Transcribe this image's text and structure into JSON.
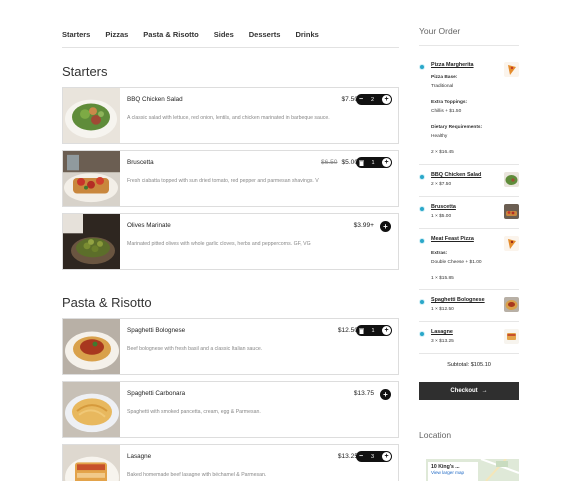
{
  "nav": [
    "Starters",
    "Pizzas",
    "Pasta & Risotto",
    "Sides",
    "Desserts",
    "Drinks"
  ],
  "sections": {
    "starters_title": "Starters",
    "pasta_title": "Pasta & Risotto"
  },
  "menu": {
    "bbq": {
      "name": "BBQ Chicken Salad",
      "price": "$7.50",
      "qty": "2",
      "desc": "A classic salad with lettuce, red onion, lentils, and chicken marinated in barbeque sauce."
    },
    "bruscetta": {
      "name": "Bruscetta",
      "old_price": "$6.50",
      "price": "$5.00",
      "qty": "1",
      "desc": "Fresh ciabatta topped with sun dried tomato, red pepper and parmesan shavings. V"
    },
    "olives": {
      "name": "Olives Marinate",
      "price": "$3.99+",
      "desc": "Marinated pitted olives with whole garlic cloves, herbs and peppercorns. GF, VG"
    },
    "bolognese": {
      "name": "Spaghetti Bolognese",
      "price": "$12.50",
      "qty": "1",
      "desc": "Beef bolognese with fresh basil and a classic Italian sauce."
    },
    "carbonara": {
      "name": "Spaghetti Carbonara",
      "price": "$13.75",
      "desc": "Spaghetti with smoked pancetta, cream, egg & Parmesan."
    },
    "lasagne": {
      "name": "Lasagne",
      "price": "$13.25",
      "qty": "3",
      "desc": "Baked homemade beef lasagne with béchamel & Parmesan."
    }
  },
  "order": {
    "title": "Your Order",
    "items": [
      {
        "name": "Pizza Margherita",
        "base_label": "Pizza Base:",
        "base_value": "Traditional",
        "toppings_label": "Extra Toppings:",
        "toppings_value": "Chillis + $1.50",
        "dietary_label": "Dietary Requirements:",
        "dietary_value": "Healthy",
        "line": "2 × $16.45"
      },
      {
        "name": "BBQ Chicken Salad",
        "line": "2 × $7.50"
      },
      {
        "name": "Bruscetta",
        "line": "1 × $5.00"
      },
      {
        "name": "Meat Feast Pizza",
        "extras_label": "Extras:",
        "extras_value": "Double Cheese + $1.00",
        "line": "1 × $15.85"
      },
      {
        "name": "Spaghetti Bolognese",
        "line": "1 × $12.50"
      },
      {
        "name": "Lasagne",
        "line": "3 × $13.25"
      }
    ],
    "subtotal": "Subtotal: $105.10",
    "checkout": "Checkout",
    "checkout_arrow": "→"
  },
  "location": {
    "title": "Location",
    "place": "10 King's ...",
    "link": "View larger map"
  },
  "icons": {
    "trash": "trash-icon",
    "minus": "minus-icon",
    "plus": "plus-icon",
    "arrow": "arrow-right-icon"
  },
  "colors": {
    "accent": "#2aa7c9",
    "button": "#111111",
    "checkout": "#2f2f2f"
  }
}
